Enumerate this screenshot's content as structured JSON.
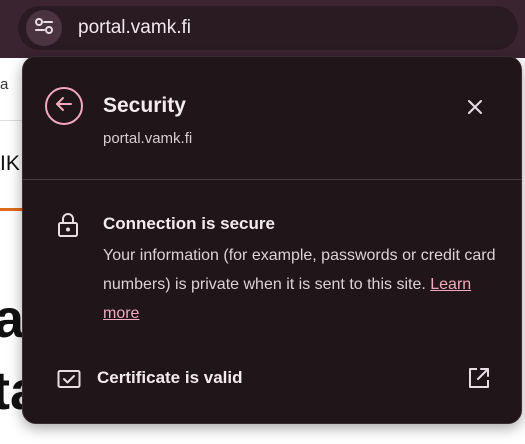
{
  "address_bar": {
    "url": "portal.vamk.fi"
  },
  "background_page": {
    "frag_a": "a",
    "frag_ik": "IK",
    "frag_big1": "al",
    "frag_big2": "ta"
  },
  "panel": {
    "title": "Security",
    "subtitle": "portal.vamk.fi",
    "connection": {
      "title": "Connection is secure",
      "description": "Your information (for example, passwords or credit card numbers) is private when it is sent to this site. ",
      "learn_more": "Learn more"
    },
    "certificate": {
      "label": "Certificate is valid"
    }
  },
  "colors": {
    "accent": "#f4a9c0",
    "panel_bg": "#201518",
    "topbar_bg": "#3a2430"
  }
}
